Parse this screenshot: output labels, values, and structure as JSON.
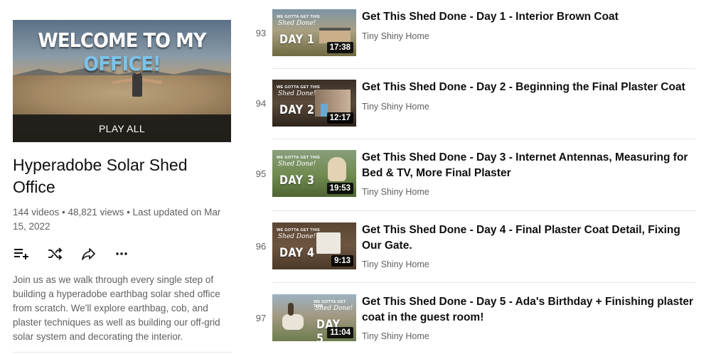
{
  "playlist": {
    "hero_title_main": "WELCOME TO MY ",
    "hero_title_accent": "OFFICE!",
    "play_all_label": "PLAY ALL",
    "title": "Hyperadobe Solar Shed Office",
    "meta": "144 videos • 48,821 views • Last updated on Mar 15, 2022",
    "description": "Join us as we walk through every single step of building a hyperadobe earthbag solar shed office from scratch. We'll explore earthbag, cob, and plaster techniques as well as building our off-grid solar system and decorating the interior.",
    "actions": [
      {
        "name": "add-to-queue-icon"
      },
      {
        "name": "shuffle-icon"
      },
      {
        "name": "share-icon"
      },
      {
        "name": "more-options-icon"
      }
    ]
  },
  "videos": [
    {
      "index": "93",
      "title": "Get This Shed Done - Day 1 - Interior Brown Coat",
      "channel": "Tiny Shiny Home",
      "duration": "17:38",
      "thumb_tag": "WE GOTTA GET THIS",
      "thumb_script": "Shed Done!",
      "thumb_day": "DAY 1"
    },
    {
      "index": "94",
      "title": "Get This Shed Done - Day 2 - Beginning the Final Plaster Coat",
      "channel": "Tiny Shiny Home",
      "duration": "12:17",
      "thumb_tag": "WE GOTTA GET THIS",
      "thumb_script": "Shed Done!",
      "thumb_day": "DAY 2"
    },
    {
      "index": "95",
      "title": "Get This Shed Done - Day 3 - Internet Antennas, Measuring for Bed & TV, More Final Plaster",
      "channel": "Tiny Shiny Home",
      "duration": "19:53",
      "thumb_tag": "WE GOTTA GET THIS",
      "thumb_script": "Shed Done!",
      "thumb_day": "DAY 3"
    },
    {
      "index": "96",
      "title": "Get This Shed Done - Day 4 - Final Plaster Coat Detail, Fixing Our Gate.",
      "channel": "Tiny Shiny Home",
      "duration": "9:13",
      "thumb_tag": "WE GOTTA GET THIS",
      "thumb_script": "Shed Done!",
      "thumb_day": "DAY 4"
    },
    {
      "index": "97",
      "title": "Get This Shed Done - Day 5 - Ada's Birthday + Finishing plaster coat in the guest room!",
      "channel": "Tiny Shiny Home",
      "duration": "11:04",
      "thumb_tag": "WE GOTTA GET THIS",
      "thumb_script": "Shed Done!",
      "thumb_day": "DAY 5"
    }
  ],
  "colors": {
    "text_primary": "#0f0f0f",
    "text_secondary": "#606060",
    "divider": "#e5e5e5",
    "hero_accent": "#7cc3e8"
  }
}
